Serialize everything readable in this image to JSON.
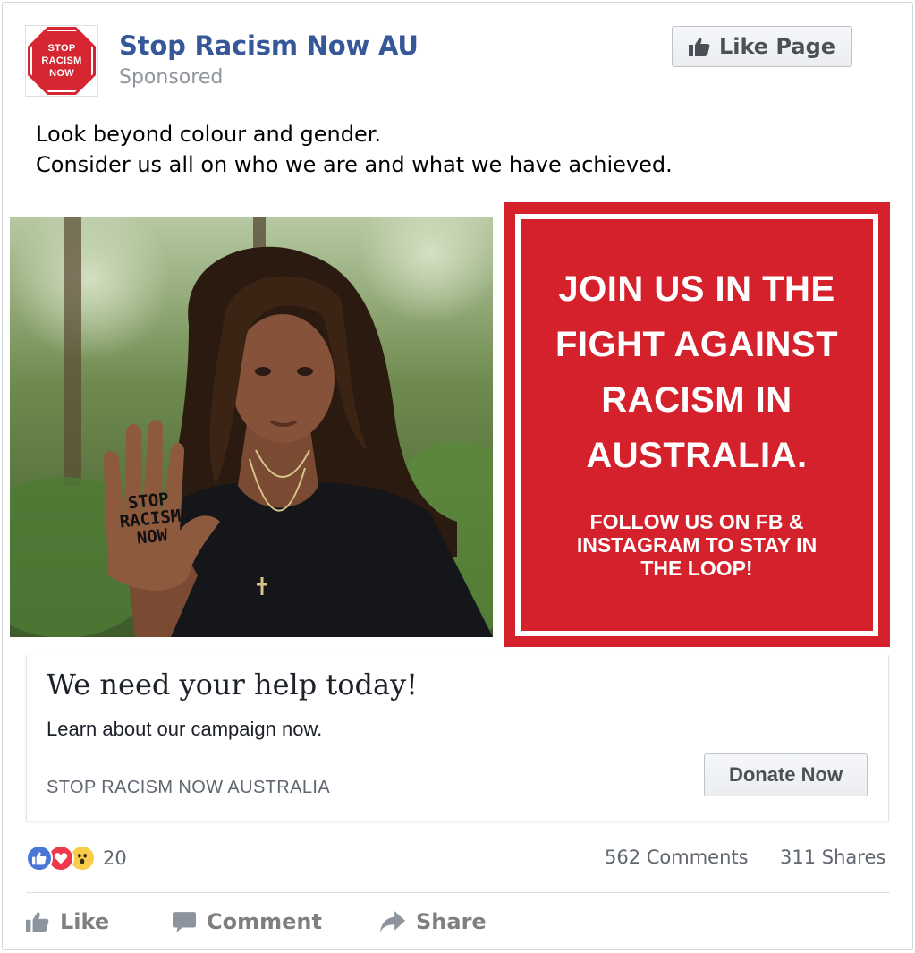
{
  "post": {
    "page_name": "Stop Racism Now AU",
    "sponsored_label": "Sponsored",
    "like_page_label": "Like Page",
    "avatar": {
      "line1": "STOP",
      "line2": "RACISM",
      "line3": "NOW"
    },
    "text_line1": "Look beyond colour and gender.",
    "text_line2": "Consider us all on who we are and what we have achieved."
  },
  "image": {
    "hand_text": "STOP\nRACISM\nNOW",
    "panel_headline": "JOIN US IN THE\nFIGHT AGAINST\nRACISM IN\nAUSTRALIA.",
    "panel_sub": "FOLLOW US ON FB &\nINSTAGRAM TO STAY IN\nTHE LOOP!"
  },
  "link": {
    "title": "We need your help today!",
    "description": "Learn about our campaign now.",
    "domain": "STOP RACISM NOW AUSTRALIA",
    "cta_label": "Donate Now"
  },
  "engagement": {
    "reaction_count": "20",
    "comments": "562 Comments",
    "shares": "311 Shares",
    "reactions": [
      "like-icon",
      "love-icon",
      "wow-icon"
    ]
  },
  "actions": {
    "like": "Like",
    "comment": "Comment",
    "share": "Share"
  },
  "colors": {
    "brand_red": "#d4212b",
    "link_blue": "#365899",
    "muted": "#90949c"
  }
}
